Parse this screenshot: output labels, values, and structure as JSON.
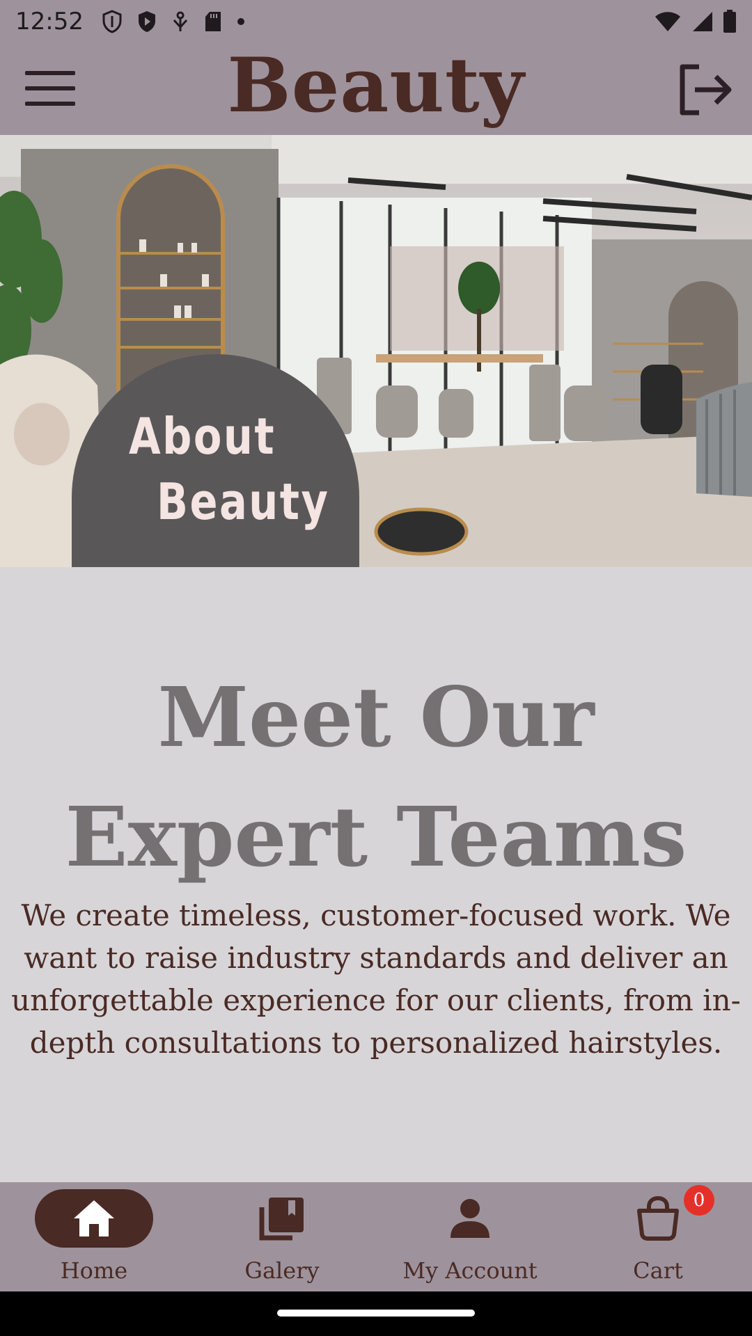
{
  "status_bar": {
    "time": "12:52",
    "icons_left": [
      "shield-outline-icon",
      "shield-play-icon",
      "usb-debug-icon",
      "sd-card-icon",
      "dot-icon"
    ],
    "icons_right": [
      "wifi-icon",
      "signal-icon",
      "battery-icon"
    ]
  },
  "app_bar": {
    "title": "Beauty",
    "menu_icon": "hamburger-menu-icon",
    "logout_icon": "logout-icon"
  },
  "hero": {
    "image_description": "salon-interior-photo",
    "badge_line1": "About",
    "badge_line2": "Beauty"
  },
  "content": {
    "heading_line1": "Meet Our",
    "heading_line2": "Expert Teams",
    "body_line1": "We create timeless, customer-focused work. We",
    "body_line2": "want to raise industry standards and deliver an",
    "body_line3": "unforgettable experience for our clients, from in-",
    "body_line4": "depth consultations to personalized hairstyles."
  },
  "bottom_nav": {
    "items": [
      {
        "label": "Home",
        "icon": "home-icon",
        "selected": true
      },
      {
        "label": "Galery",
        "icon": "gallery-icon",
        "selected": false
      },
      {
        "label": "My Account",
        "icon": "person-icon",
        "selected": false
      },
      {
        "label": "Cart",
        "icon": "cart-icon",
        "selected": false,
        "badge": "0"
      }
    ]
  },
  "colors": {
    "bar_background": "#9e939c",
    "page_background": "#d7d5d8",
    "brand_brown": "#4a2a24",
    "heading_gray": "#757072",
    "badge_gray": "#5a5759",
    "badge_text": "#f4e4e2",
    "cart_badge_red": "#e5302a"
  }
}
